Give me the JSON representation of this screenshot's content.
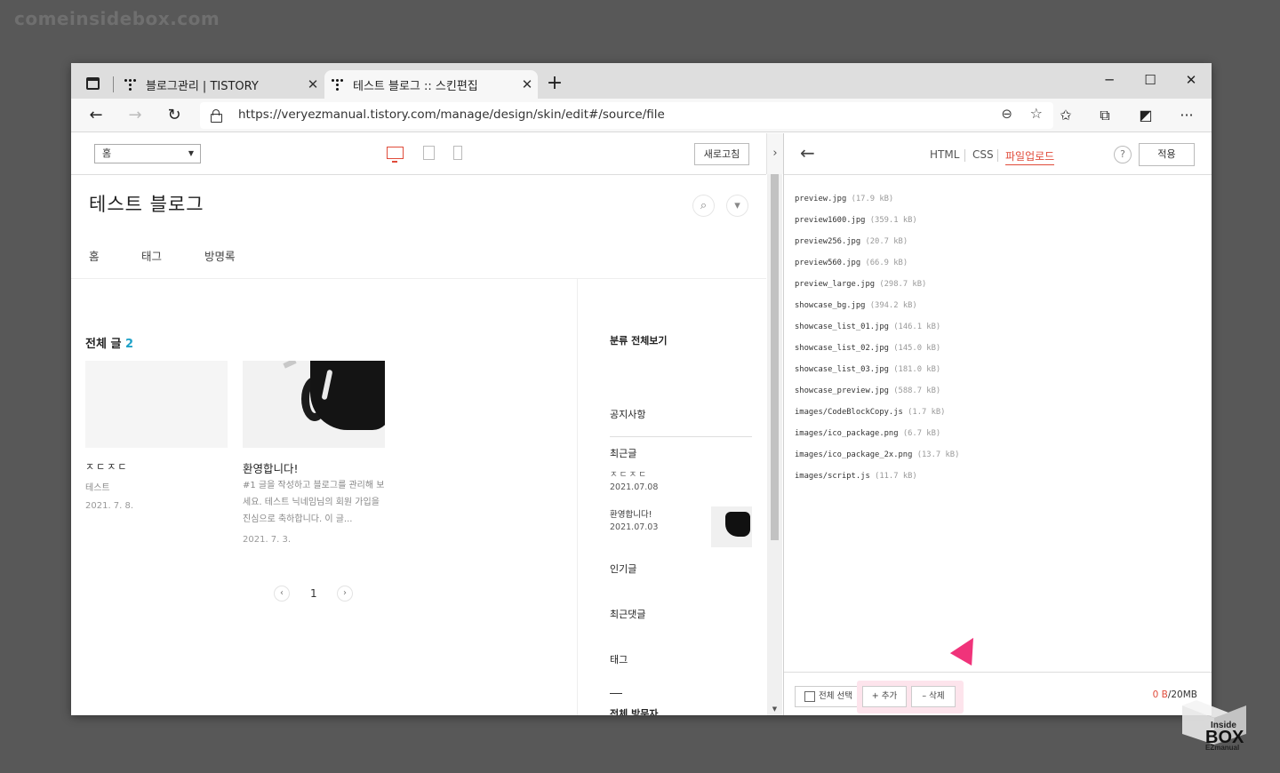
{
  "watermark": "comeinsidebox.com",
  "browser": {
    "tabs": [
      {
        "title": "블로그관리 | TISTORY",
        "active": false
      },
      {
        "title": "테스트 블로그 :: 스킨편집",
        "active": true
      }
    ],
    "url": "https://veryezmanual.tistory.com/manage/design/skin/edit#/source/file"
  },
  "preview": {
    "dropdown_value": "홈",
    "refresh_label": "새로고침",
    "blog_title": "테스트 블로그",
    "menu": [
      "홈",
      "태그",
      "방명록"
    ],
    "all_posts_label": "전체 글",
    "all_posts_count": "2",
    "posts": [
      {
        "title": "ㅈㄷㅈㄷ",
        "category": "테스트",
        "date": "2021. 7. 8."
      },
      {
        "title": "환영합니다!",
        "excerpt": "#1 글을 작성하고 블로그를 관리해 보세요. 테스트 닉네임님의 회원 가입을 진심으로 축하합니다. 이 글...",
        "date": "2021. 7. 3."
      }
    ],
    "page_number": "1",
    "sidebar": {
      "category_all": "분류 전체보기",
      "notice": "공지사항",
      "recent_posts": "최근글",
      "recent": [
        {
          "title": "ㅈㄷㅈㄷ",
          "date": "2021.07.08"
        },
        {
          "title": "환영합니다!",
          "date": "2021.07.03"
        }
      ],
      "popular": "인기글",
      "recent_comments": "최근댓글",
      "tags": "태그",
      "visitors": "전체 방문자"
    }
  },
  "editor": {
    "tabs": [
      "HTML",
      "CSS",
      "파일업로드"
    ],
    "active_tab": "파일업로드",
    "help_label": "?",
    "apply_label": "적용",
    "files": [
      {
        "name": "preview.jpg",
        "size": "(17.9 kB)"
      },
      {
        "name": "preview1600.jpg",
        "size": "(359.1 kB)"
      },
      {
        "name": "preview256.jpg",
        "size": "(20.7 kB)"
      },
      {
        "name": "preview560.jpg",
        "size": "(66.9 kB)"
      },
      {
        "name": "preview_large.jpg",
        "size": "(298.7 kB)"
      },
      {
        "name": "showcase_bg.jpg",
        "size": "(394.2 kB)"
      },
      {
        "name": "showcase_list_01.jpg",
        "size": "(146.1 kB)"
      },
      {
        "name": "showcase_list_02.jpg",
        "size": "(145.0 kB)"
      },
      {
        "name": "showcase_list_03.jpg",
        "size": "(181.0 kB)"
      },
      {
        "name": "showcase_preview.jpg",
        "size": "(588.7 kB)"
      },
      {
        "name": "images/CodeBlockCopy.js",
        "size": "(1.7 kB)"
      },
      {
        "name": "images/ico_package.png",
        "size": "(6.7 kB)"
      },
      {
        "name": "images/ico_package_2x.png",
        "size": "(13.7 kB)"
      },
      {
        "name": "images/script.js",
        "size": "(11.7 kB)"
      }
    ],
    "select_all_label": "전체 선택",
    "add_label": "+ 추가",
    "delete_label": "– 삭제",
    "usage_used": "0 B",
    "usage_total": "/20MB"
  },
  "logo": {
    "line1": "Inside",
    "line2": "BOX",
    "line3": "EZmanual"
  },
  "colors": {
    "accent": "#e04b3a",
    "pointer": "#f0337a",
    "count": "#1fa2c8"
  }
}
